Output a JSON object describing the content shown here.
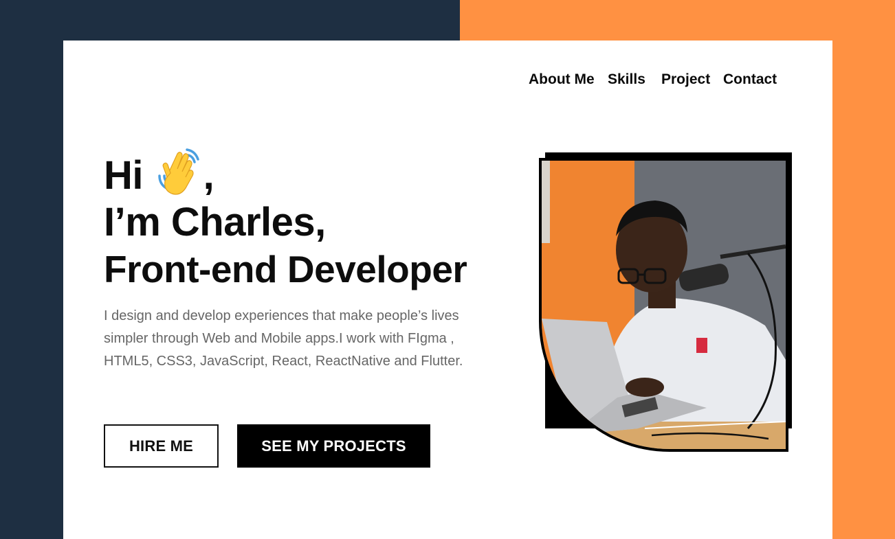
{
  "nav": {
    "items": [
      {
        "label": "About Me"
      },
      {
        "label": "Skills"
      },
      {
        "label": "Project"
      },
      {
        "label": "Contact"
      }
    ]
  },
  "hero": {
    "line1_text": "Hi",
    "line1_suffix": ",",
    "wave_emoji_icon": "waving-hand-icon",
    "line2": "I’m Charles,",
    "line3": "Front-end Developer",
    "description": "I design and develop experiences that make people’s lives simpler through Web and Mobile apps.I work with FIgma , HTML5, CSS3, JavaScript, React, ReactNative and Flutter."
  },
  "buttons": {
    "hire": "HIRE ME",
    "projects": "SEE MY PROJECTS"
  },
  "colors": {
    "navy": "#1e2f42",
    "orange": "#ff9142",
    "white": "#ffffff",
    "black": "#000000",
    "text_gray": "#666666"
  }
}
